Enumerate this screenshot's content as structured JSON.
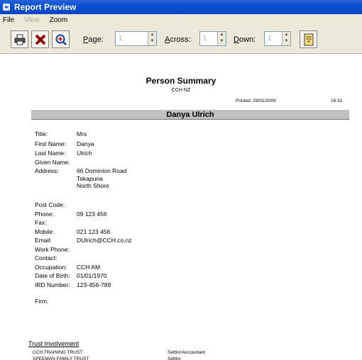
{
  "window": {
    "title": "Report Preview"
  },
  "menu": {
    "file": "File",
    "view": "View",
    "zoom": "Zoom"
  },
  "toolbar": {
    "print_icon": "printer-icon",
    "close_icon": "close-x-icon",
    "zoom_icon": "zoom-in-icon",
    "export_icon": "pdf-export-icon",
    "page_label_key": "P",
    "page_label_rest": "age:",
    "page_value": "1",
    "across_label_key": "A",
    "across_label_rest": "cross:",
    "across_value": "1",
    "down_label_key": "D",
    "down_label_rest": "own:",
    "down_value": "1"
  },
  "report": {
    "title": "Person Summary",
    "company": "CCH NZ",
    "printed": "Printed: 29/01/2009",
    "time": "16:31",
    "person_name": "Danya Ulrich",
    "fields": [
      {
        "label": "Title:",
        "value": "Mrs"
      },
      {
        "label": "First Name:",
        "value": "Danya"
      },
      {
        "label": "Last Name:",
        "value": "Ulrich"
      },
      {
        "label": "Given Name:",
        "value": ""
      },
      {
        "label": "Address:",
        "value": "66 Dominion Road"
      },
      {
        "label": "",
        "value": "Takapuna"
      },
      {
        "label": "",
        "value": "North Shore"
      },
      {
        "label": "Post Code:",
        "value": ""
      },
      {
        "label": "Phone:",
        "value": "09 123 456"
      },
      {
        "label": "Fax:",
        "value": ""
      },
      {
        "label": "Mobile:",
        "value": "021 123 456"
      },
      {
        "label": "Email:",
        "value": "DUlrich@CCH.co.nz"
      },
      {
        "label": "Work Phone:",
        "value": ""
      },
      {
        "label": "Contact:",
        "value": ""
      },
      {
        "label": "Occupation:",
        "value": "CCH AM"
      },
      {
        "label": "Date of Birth:",
        "value": "01/01/1970"
      },
      {
        "label": "IRD Number:",
        "value": "123-456-789"
      },
      {
        "label": "Firm:",
        "value": ""
      }
    ],
    "trust_heading": "Trust Involvement",
    "trusts": [
      {
        "name": "CCH TRAINING TRUST",
        "role": "Settlor/Accountant"
      },
      {
        "name": "SPEEMAN FAMILY TRUST",
        "role": "Settlor"
      }
    ]
  }
}
